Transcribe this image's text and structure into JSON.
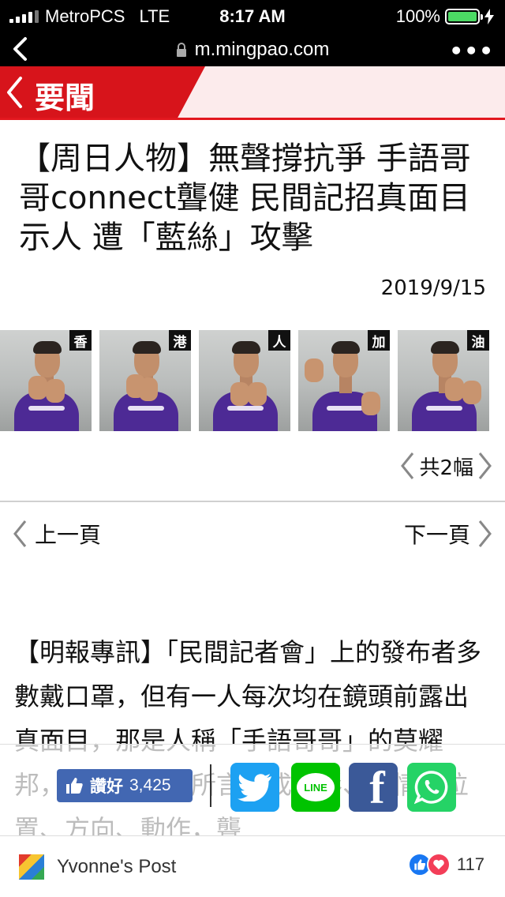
{
  "status_bar": {
    "carrier": "MetroPCS",
    "network": "LTE",
    "time": "8:17 AM",
    "battery_percent": "100%",
    "battery_level": 1.0,
    "signal_bars": 3
  },
  "url_bar": {
    "url": "m.mingpao.com",
    "more_label": "•••"
  },
  "section": {
    "title": "要聞",
    "accent_color": "#d7141b"
  },
  "article": {
    "headline": "【周日人物】無聲撐抗爭 手語哥哥connect聾健 民間記招真面目示人 遭「藍絲」攻擊",
    "date": "2019/9/15",
    "image_tags": [
      "香",
      "港",
      "人",
      "加",
      "油"
    ],
    "image_count_label": "共2幅",
    "body": "【明報專訊】「民間記者會」上的發布者多數戴口罩，但有一人每次均在鏡頭前露出真面目，那是人稱「手語哥哥」的莫耀邦，他將發布者所言轉成手形、表情、位置、方向、動作，聾"
  },
  "pagination": {
    "prev_label": "上一頁",
    "next_label": "下一頁"
  },
  "share": {
    "like_label": "讚好",
    "like_count": "3,425",
    "line_label": "LINE",
    "facebook_glyph": "f"
  },
  "bottom_bar": {
    "poster_name": "Yvonne's Post",
    "reaction_count": "117"
  }
}
